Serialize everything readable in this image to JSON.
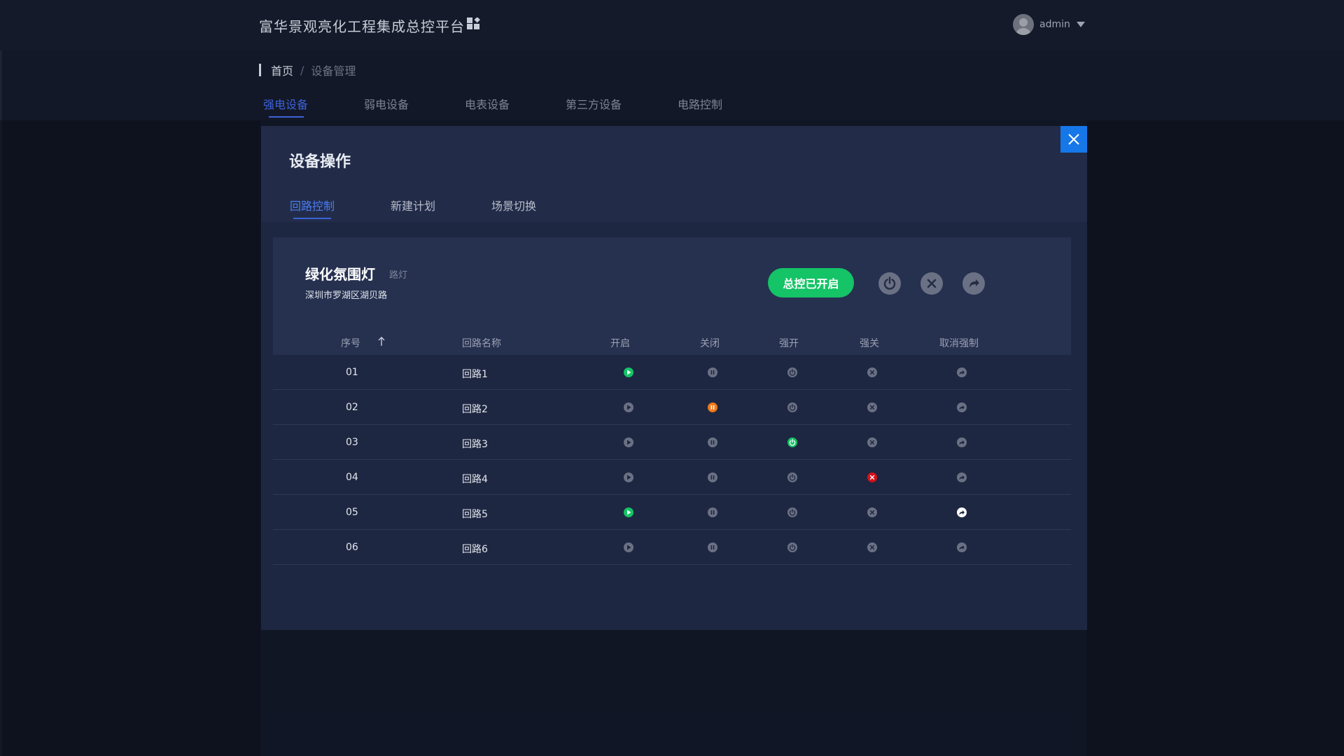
{
  "header": {
    "app_title": "富华景观亮化工程集成总控平台",
    "username": "admin"
  },
  "breadcrumb": {
    "home": "首页",
    "separator": "/",
    "current": "设备管理"
  },
  "main_tabs": [
    {
      "label": "强电设备",
      "active": true
    },
    {
      "label": "弱电设备",
      "active": false
    },
    {
      "label": "电表设备",
      "active": false
    },
    {
      "label": "第三方设备",
      "active": false
    },
    {
      "label": "电路控制",
      "active": false
    }
  ],
  "modal": {
    "title": "设备操作",
    "tabs": [
      {
        "label": "回路控制",
        "active": true
      },
      {
        "label": "新建计划",
        "active": false
      },
      {
        "label": "场景切换",
        "active": false
      }
    ],
    "device": {
      "name": "绿化氛围灯",
      "type": "路灯",
      "address": "深圳市罗湖区湖贝路"
    },
    "master_button": "总控已开启",
    "table": {
      "headers": {
        "index": "序号",
        "name": "回路名称",
        "open": "开启",
        "close": "关闭",
        "force_open": "强开",
        "force_close": "强关",
        "cancel_force": "取消强制"
      },
      "rows": [
        {
          "index": "01",
          "name": "回路1",
          "active": "open"
        },
        {
          "index": "02",
          "name": "回路2",
          "active": "close"
        },
        {
          "index": "03",
          "name": "回路3",
          "active": "force_open"
        },
        {
          "index": "04",
          "name": "回路4",
          "active": "force_close"
        },
        {
          "index": "05",
          "name": "回路5",
          "active": "open,cancel_force"
        },
        {
          "index": "06",
          "name": "回路6",
          "active": ""
        }
      ]
    }
  },
  "colors": {
    "accent": "#3d62d9",
    "close_button": "#1677e8",
    "green": "#14c466",
    "orange": "#f07a1a",
    "red": "#d8101a",
    "inactive_icon": "#6b7184"
  }
}
